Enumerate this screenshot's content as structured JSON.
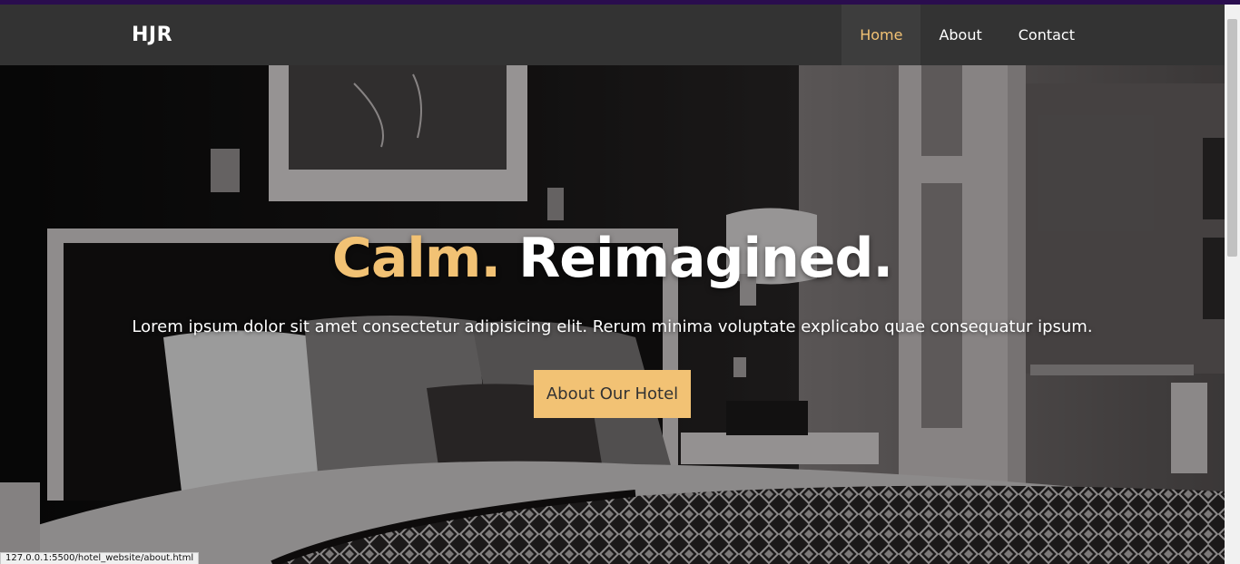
{
  "navbar": {
    "brand": "HJR",
    "links": [
      {
        "label": "Home",
        "active": true
      },
      {
        "label": "About",
        "active": false
      },
      {
        "label": "Contact",
        "active": false
      }
    ]
  },
  "hero": {
    "title_accent": "Calm.",
    "title_rest": "Reimagined.",
    "subtitle": "Lorem ipsum dolor sit amet consectetur adipisicing elit. Rerum minima voluptate explicabo quae consequatur ipsum.",
    "cta_label": "About Our Hotel"
  },
  "status_bar": {
    "url": "127.0.0.1:5500/hotel_website/about.html"
  },
  "colors": {
    "accent": "#f2c274",
    "navbar": "#333333",
    "top_accent": "#2a0d4e"
  }
}
